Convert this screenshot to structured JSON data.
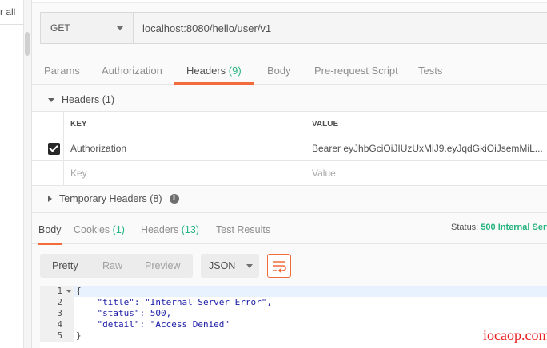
{
  "sidebar": {
    "clear_all": "r all"
  },
  "request": {
    "method": "GET",
    "url": "localhost:8080/hello/user/v1"
  },
  "request_tabs": [
    {
      "label": "Params"
    },
    {
      "label": "Authorization"
    },
    {
      "label": "Headers",
      "count": "(9)"
    },
    {
      "label": "Body"
    },
    {
      "label": "Pre-request Script"
    },
    {
      "label": "Tests"
    }
  ],
  "headers_section": {
    "title": "Headers (1)",
    "columns": {
      "key": "KEY",
      "value": "VALUE"
    },
    "rows": [
      {
        "checked": true,
        "key": "Authorization",
        "value": "Bearer eyJhbGciOiJIUzUxMiJ9.eyJqdGkiOiJsemMiL..."
      }
    ],
    "placeholder_key": "Key",
    "placeholder_value": "Value"
  },
  "temporary_headers": {
    "title": "Temporary Headers (8)",
    "info_icon": "i"
  },
  "response_tabs": [
    {
      "label": "Body"
    },
    {
      "label": "Cookies",
      "count": "(1)"
    },
    {
      "label": "Headers",
      "count": "(13)"
    },
    {
      "label": "Test Results"
    }
  ],
  "status": {
    "label": "Status:",
    "value": "500 Internal Serv"
  },
  "view_modes": [
    "Pretty",
    "Raw",
    "Preview"
  ],
  "format": "JSON",
  "code": {
    "line_numbers": [
      "1",
      "2",
      "3",
      "4",
      "5"
    ],
    "lines": [
      "{",
      "    \"title\": \"Internal Server Error\",",
      "    \"status\": 500,",
      "    \"detail\": \"Access Denied\"",
      "}"
    ]
  },
  "watermark": "iocaop.com",
  "colors": {
    "accent": "#f26b3a",
    "green": "#26b47f"
  }
}
